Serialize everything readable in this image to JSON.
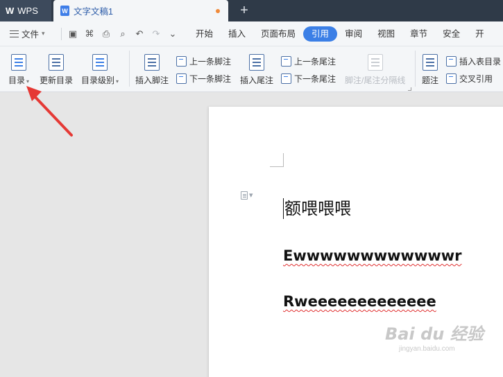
{
  "titlebar": {
    "app_tab_label": "WPS",
    "doc_tab_label": "文字文稿1",
    "new_tab_symbol": "+"
  },
  "menubar": {
    "file_label": "文件",
    "tabs": [
      "开始",
      "插入",
      "页面布局",
      "引用",
      "审阅",
      "视图",
      "章节",
      "安全",
      "开"
    ],
    "active_tab": "引用"
  },
  "ribbon": {
    "toc": "目录",
    "update_toc": "更新目录",
    "toc_level": "目录级别",
    "insert_footnote": "插入脚注",
    "prev_footnote": "上一条脚注",
    "next_footnote": "下一条脚注",
    "insert_endnote": "插入尾注",
    "prev_endnote": "上一条尾注",
    "next_endnote": "下一条尾注",
    "separator_line": "脚注/尾注分隔线",
    "caption": "题注",
    "insert_table_of_figures": "插入表目录",
    "cross_reference": "交叉引用"
  },
  "document": {
    "heading1": "额喂喂喂",
    "line2": "Ewwwwwwwwwwwwr",
    "line3": "Rweeeeeeeeeeeee"
  },
  "watermark": {
    "logo": "Bai du 经验",
    "url": "jingyan.baidu.com"
  },
  "colors": {
    "accent": "#3b7fe6",
    "titlebar": "#2f3a48",
    "annotation_arrow": "#e53935",
    "spellcheck": "#e03030"
  }
}
